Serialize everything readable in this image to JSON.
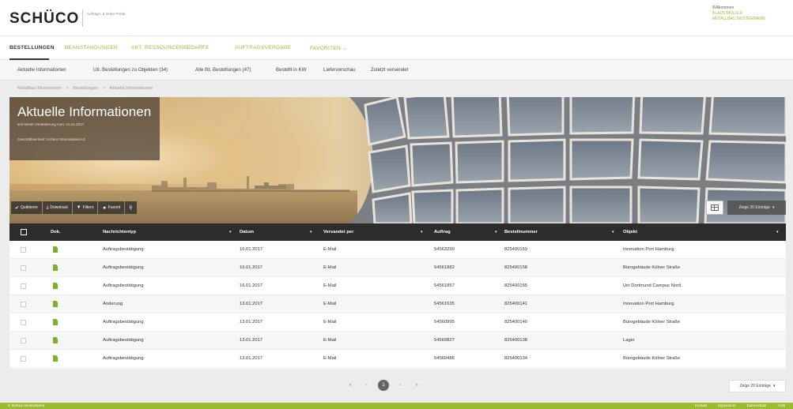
{
  "header": {
    "logo": "SCHÜCO",
    "logo_sub": "Auftrags- & Order Portal",
    "welcome_label": "Willkommen",
    "user_name": "KLAUS MÜLLER",
    "company": "METALLBAU MUSTERMANN"
  },
  "mainnav": {
    "items": [
      {
        "label": "BESTELLUNGEN"
      },
      {
        "label": "BEANSTANDUNGEN"
      },
      {
        "label": "AKT. RESSOURCENBEDARFE"
      },
      {
        "label": "AUFTRAGSVERGABE"
      },
      {
        "label": "FAVORITEN ⌄"
      }
    ]
  },
  "subnav": {
    "items": [
      {
        "label": "Aktuelle Informationen"
      },
      {
        "label": "Utl. Bestellungen zu Objekten (34)"
      },
      {
        "label": "Alle lfd. Bestellungen (47)"
      },
      {
        "label": "Bestellt in KW"
      },
      {
        "label": "Liefervorschau"
      },
      {
        "label": "Zuletzt versendet"
      }
    ]
  },
  "breadcrumb": [
    "Metallbau Mustermann",
    ">",
    "Bestellungen",
    ">",
    "Aktuelle Informationen"
  ],
  "hero": {
    "title": "Aktuelle Informationen",
    "subtitle": "seit letzter Gerätsierung vom: 12.01.2017",
    "company_line": "Geschäftseinheit: Schüco International AG"
  },
  "toolbar": {
    "buttons": [
      {
        "label": "Quittieren",
        "icon": "check-icon"
      },
      {
        "label": "Download",
        "icon": "download-icon"
      },
      {
        "label": "Filtern",
        "icon": "filter-icon"
      },
      {
        "label": "Favorit",
        "icon": "star-icon"
      },
      {
        "label": "",
        "icon": "search-icon"
      }
    ],
    "entries_label": "Zeige 20 Einträge"
  },
  "table": {
    "columns": [
      "Dok.",
      "Nachrichtentyp",
      "Datum",
      "Versandet per",
      "Auftrag",
      "Bestellnummer",
      "Objekt"
    ],
    "rows": [
      {
        "type": "Auftragsbestätigung",
        "date": "16.01.2017",
        "via": "E-Mail",
        "order": "54563290",
        "po": "825400159",
        "object": "Innovation Port Hamburg"
      },
      {
        "type": "Auftragsbestätigung",
        "date": "16.01.2017",
        "via": "E-Mail",
        "order": "54561882",
        "po": "825400158",
        "object": "Bürogebäude Kölner Straße"
      },
      {
        "type": "Auftragsbestätigung",
        "date": "16.01.2017",
        "via": "E-Mail",
        "order": "54561857",
        "po": "825400155",
        "object": "Uni Dortmund Campus Nord"
      },
      {
        "type": "Anderung",
        "date": "13.01.2017",
        "via": "E-Mail",
        "order": "54561635",
        "po": "825400141",
        "object": "Innovation Port Hamburg"
      },
      {
        "type": "Auftragsbestätigung",
        "date": "13.01.2017",
        "via": "E-Mail",
        "order": "54560995",
        "po": "825400140",
        "object": "Bürogebäude Kölner Straße"
      },
      {
        "type": "Auftragsbestätigung",
        "date": "13.01.2017",
        "via": "E-Mail",
        "order": "54560827",
        "po": "825400138",
        "object": "Lager"
      },
      {
        "type": "Auftragsbestätigung",
        "date": "13.01.2017",
        "via": "E-Mail",
        "order": "54560488",
        "po": "825400134",
        "object": "Bürogebäude Kölner Straße"
      }
    ]
  },
  "pagination": {
    "first": "«",
    "prev": "‹",
    "current": "1",
    "next": "›",
    "last": "»",
    "entries_label": "Zeige 20 Einträge"
  },
  "footer": {
    "copyright": "© Schüco Deutschland",
    "links": [
      "Kontakt",
      "Impressum",
      "Datenschutz",
      "AGB"
    ]
  },
  "colors": {
    "accent": "#9cbc2f",
    "header_dark": "#2c2c2c"
  }
}
